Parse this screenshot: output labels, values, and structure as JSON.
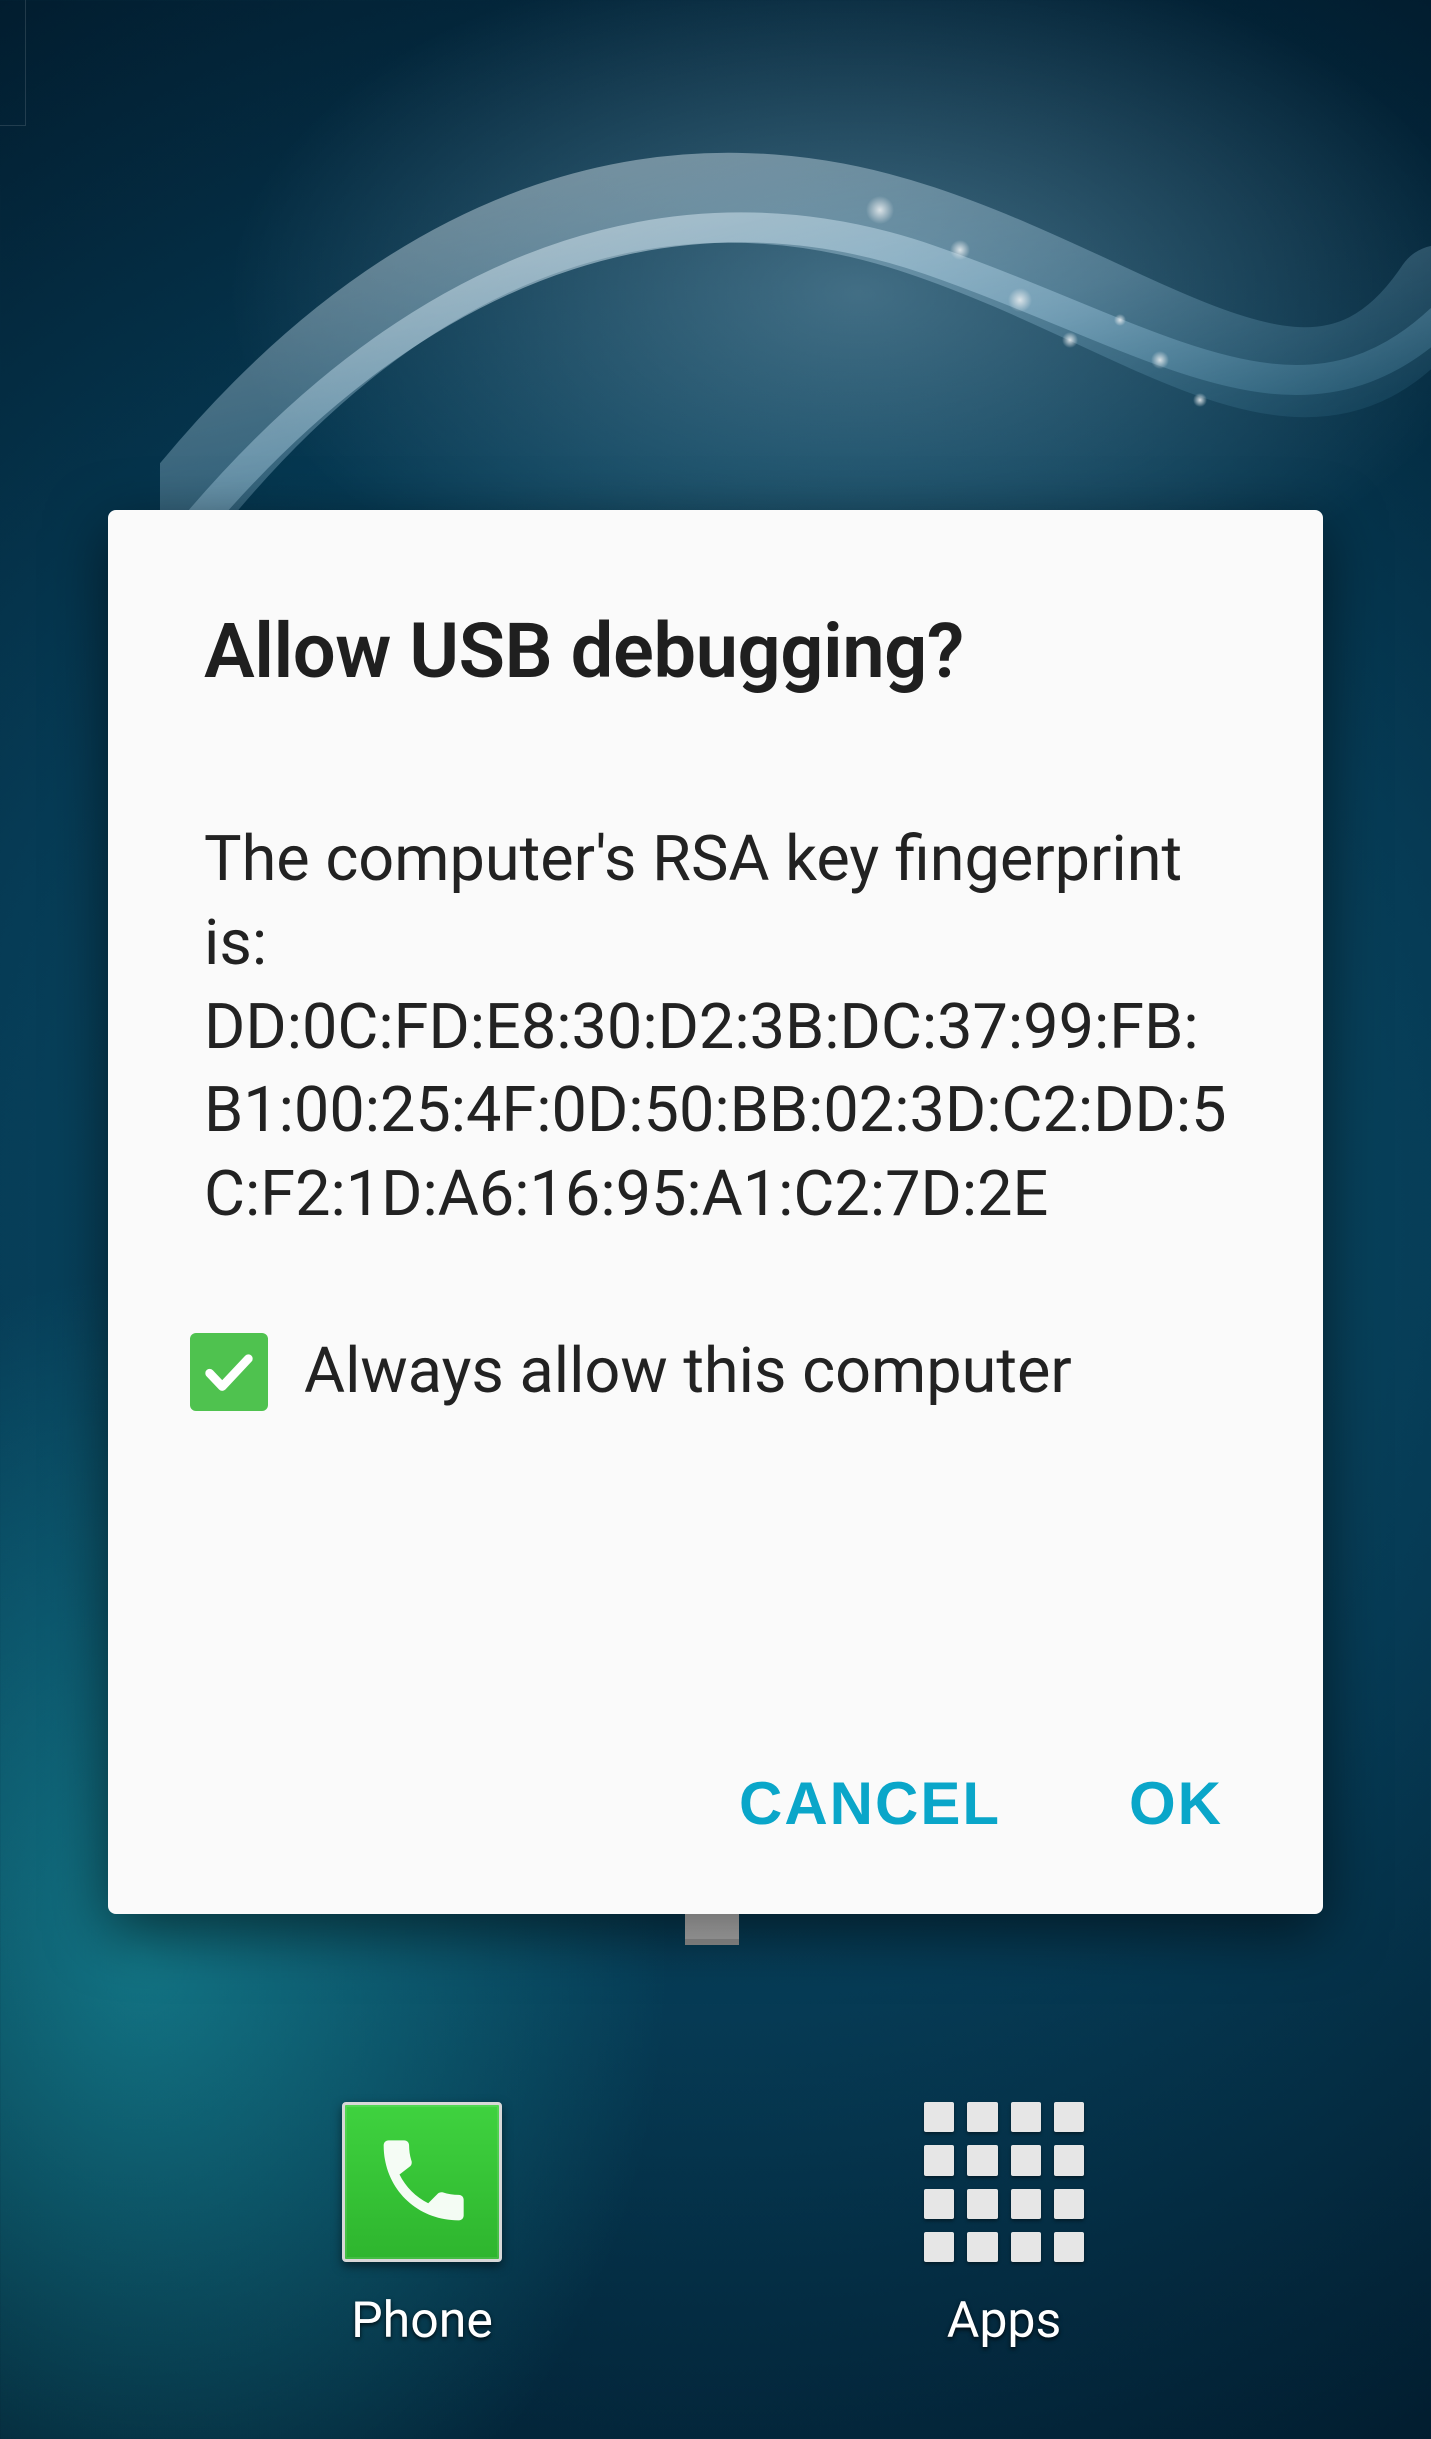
{
  "dialog": {
    "title": "Allow USB debugging?",
    "message_intro": "The computer's RSA key fingerprint is:",
    "fingerprint": "DD:0C:FD:E8:30:D2:3B:DC:37:99:FB:B1:00:25:4F:0D:50:BB:02:3D:C2:DD:5C:F2:1D:A6:16:95:A1:C2:7D:2E",
    "checkbox_label": "Always allow this computer",
    "checkbox_checked": true,
    "cancel_label": "CANCEL",
    "ok_label": "OK"
  },
  "dock": {
    "phone_label": "Phone",
    "apps_label": "Apps"
  },
  "colors": {
    "accent": "#0aa6c9",
    "checkbox_bg": "#4fc24f"
  }
}
